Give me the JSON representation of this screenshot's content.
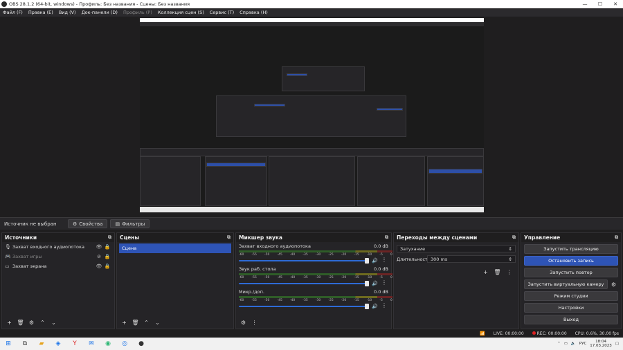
{
  "window": {
    "title": "OBS 28.1.2 (64-bit, windows) - Профиль: Без названия - Сцены: Без названия",
    "min": "—",
    "max": "☐",
    "close": "✕"
  },
  "menu": [
    {
      "label": "Файл (F)"
    },
    {
      "label": "Правка (E)"
    },
    {
      "label": "Вид (V)"
    },
    {
      "label": "Док-панели (D)"
    },
    {
      "label": "Профиль (P)"
    },
    {
      "label": "Коллекция сцен (S)"
    },
    {
      "label": "Сервис (T)"
    },
    {
      "label": "Справка (H)"
    }
  ],
  "source_bar": {
    "no_selection": "Источник не выбран",
    "properties": "Свойства",
    "filters": "Фильтры"
  },
  "sources": {
    "title": "Источники",
    "items": [
      {
        "label": "Захват входного аудиопотока",
        "icon": "microphone-icon"
      },
      {
        "label": "Захват игры",
        "icon": "gamepad-icon"
      },
      {
        "label": "Захват экрана",
        "icon": "monitor-icon"
      }
    ]
  },
  "scenes": {
    "title": "Сцены",
    "items": [
      {
        "label": "Сцена"
      }
    ]
  },
  "mixer": {
    "title": "Микшер звука",
    "scale": [
      "-60",
      "-55",
      "-50",
      "-45",
      "-40",
      "-35",
      "-30",
      "-25",
      "-20",
      "-15",
      "-10",
      "-5",
      "0"
    ],
    "channels": [
      {
        "name": "Захват входного аудиопотока",
        "db": "0.0 dB"
      },
      {
        "name": "Звук раб. стола",
        "db": "0.0 dB"
      },
      {
        "name": "Микр./доп.",
        "db": "0.0 dB"
      }
    ]
  },
  "transitions": {
    "title": "Переходы между сценами",
    "type": "Затухание",
    "duration_label": "Длительность",
    "duration_value": "300 ms"
  },
  "controls": {
    "title": "Управление",
    "buttons": [
      {
        "label": "Запустить трансляцию"
      },
      {
        "label": "Остановить запись"
      },
      {
        "label": "Запустить повтор"
      },
      {
        "label": "Запустить виртуальную камеру"
      },
      {
        "label": "Режим студии"
      },
      {
        "label": "Настройки"
      },
      {
        "label": "Выход"
      }
    ]
  },
  "status": {
    "live": "LIVE: 00:00:00",
    "rec": "REC: 00:00:00",
    "cpu": "CPU: 0.6%, 30.00 fps"
  },
  "taskbar": {
    "lang": "РУС",
    "time": "18:04",
    "date": "17.03.2023"
  },
  "colors": {
    "accent": "#2e54b6",
    "rec": "#dd2222"
  }
}
